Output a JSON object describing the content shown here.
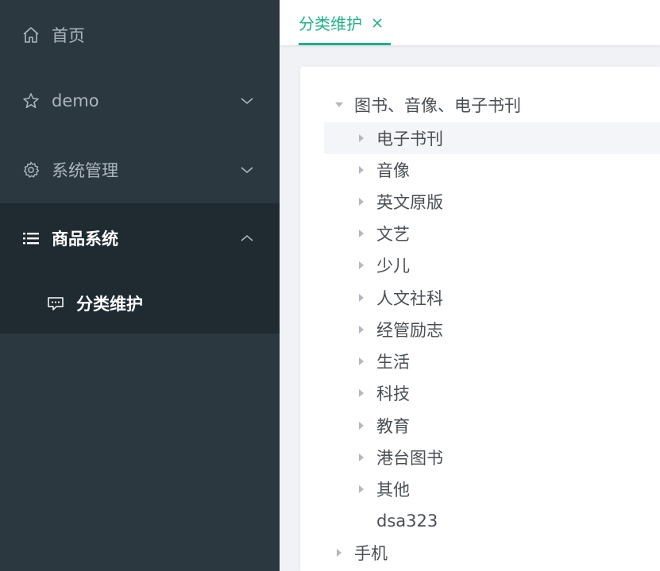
{
  "sidebar": {
    "items": [
      {
        "label": "首页",
        "icon": "home-icon"
      },
      {
        "label": "demo",
        "icon": "star-icon"
      },
      {
        "label": "系统管理",
        "icon": "gear-icon"
      },
      {
        "label": "商品系统",
        "icon": "list-icon"
      }
    ],
    "submenu": [
      {
        "label": "分类维护",
        "icon": "chat-icon"
      }
    ]
  },
  "tabs": [
    {
      "label": "分类维护",
      "active": true
    }
  ],
  "tree": {
    "root": "图书、音像、电子书刊",
    "children": [
      "电子书刊",
      "音像",
      "英文原版",
      "文艺",
      "少儿",
      "人文社科",
      "经管励志",
      "生活",
      "科技",
      "教育",
      "港台图书",
      "其他",
      "dsa323"
    ],
    "second_root": "手机"
  },
  "colors": {
    "sidebar_bg": "#2b3840",
    "accent": "#1fb18a"
  }
}
